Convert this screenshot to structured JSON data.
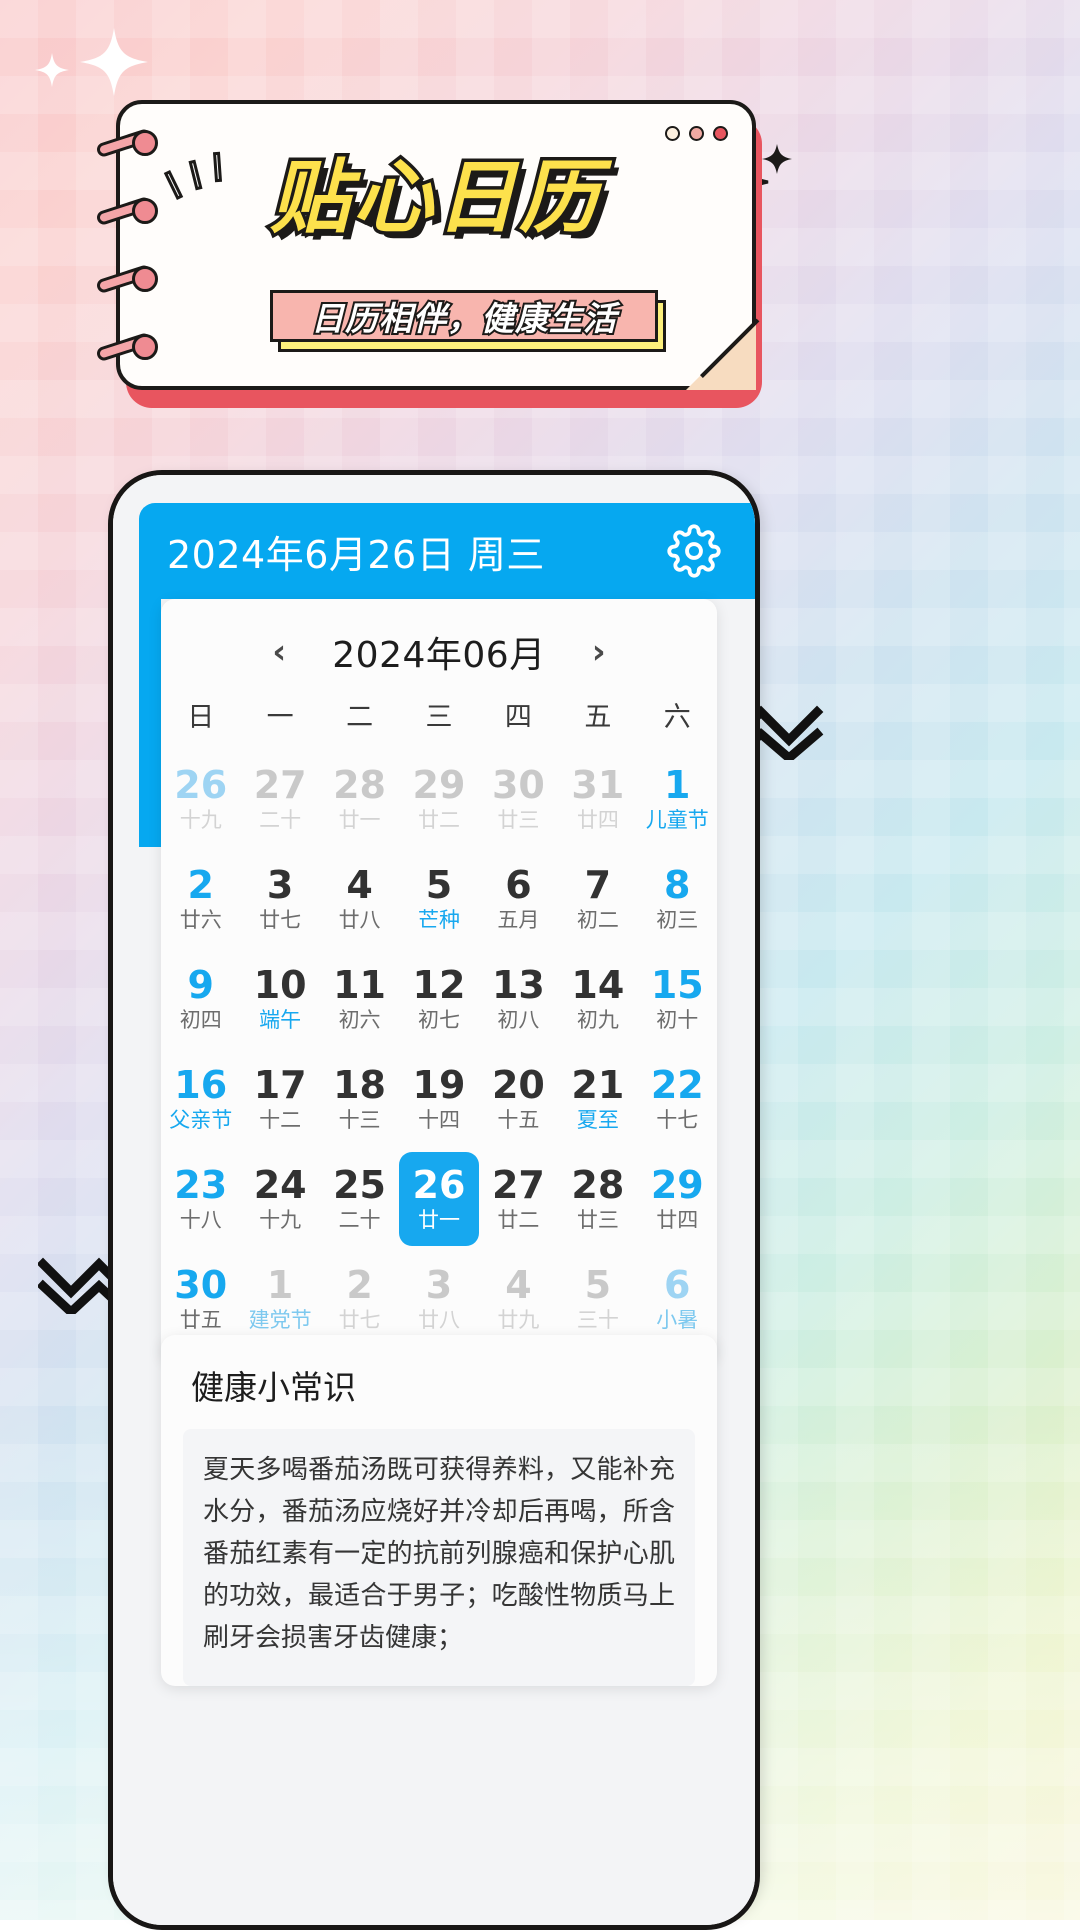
{
  "banner": {
    "title": "贴心日历",
    "subtitle": "日历相伴，健康生活",
    "dots": [
      "window-dot-1",
      "window-dot-2",
      "window-dot-3"
    ]
  },
  "app": {
    "header": {
      "date_text": "2024年6月26日 周三",
      "settings_icon": "gear-icon"
    },
    "calendar": {
      "prev_label": "‹",
      "next_label": "›",
      "title": "2024年06月",
      "weekdays": [
        "日",
        "一",
        "二",
        "三",
        "四",
        "五",
        "六"
      ],
      "weeks": [
        [
          {
            "num": "26",
            "lunar": "十九",
            "state": "out",
            "weekend": true,
            "festival": false
          },
          {
            "num": "27",
            "lunar": "二十",
            "state": "out",
            "weekend": false,
            "festival": false
          },
          {
            "num": "28",
            "lunar": "廿一",
            "state": "out",
            "weekend": false,
            "festival": false
          },
          {
            "num": "29",
            "lunar": "廿二",
            "state": "out",
            "weekend": false,
            "festival": false
          },
          {
            "num": "30",
            "lunar": "廿三",
            "state": "out",
            "weekend": false,
            "festival": false
          },
          {
            "num": "31",
            "lunar": "廿四",
            "state": "out",
            "weekend": false,
            "festival": false
          },
          {
            "num": "1",
            "lunar": "儿童节",
            "state": "cur",
            "weekend": true,
            "festival": true
          }
        ],
        [
          {
            "num": "2",
            "lunar": "廿六",
            "state": "cur",
            "weekend": true,
            "festival": false
          },
          {
            "num": "3",
            "lunar": "廿七",
            "state": "cur",
            "weekend": false,
            "festival": false
          },
          {
            "num": "4",
            "lunar": "廿八",
            "state": "cur",
            "weekend": false,
            "festival": false
          },
          {
            "num": "5",
            "lunar": "芒种",
            "state": "cur",
            "weekend": false,
            "festival": true
          },
          {
            "num": "6",
            "lunar": "五月",
            "state": "cur",
            "weekend": false,
            "festival": false
          },
          {
            "num": "7",
            "lunar": "初二",
            "state": "cur",
            "weekend": false,
            "festival": false
          },
          {
            "num": "8",
            "lunar": "初三",
            "state": "cur",
            "weekend": true,
            "festival": false
          }
        ],
        [
          {
            "num": "9",
            "lunar": "初四",
            "state": "cur",
            "weekend": true,
            "festival": false
          },
          {
            "num": "10",
            "lunar": "端午",
            "state": "cur",
            "weekend": false,
            "festival": true
          },
          {
            "num": "11",
            "lunar": "初六",
            "state": "cur",
            "weekend": false,
            "festival": false
          },
          {
            "num": "12",
            "lunar": "初七",
            "state": "cur",
            "weekend": false,
            "festival": false
          },
          {
            "num": "13",
            "lunar": "初八",
            "state": "cur",
            "weekend": false,
            "festival": false
          },
          {
            "num": "14",
            "lunar": "初九",
            "state": "cur",
            "weekend": false,
            "festival": false
          },
          {
            "num": "15",
            "lunar": "初十",
            "state": "cur",
            "weekend": true,
            "festival": false
          }
        ],
        [
          {
            "num": "16",
            "lunar": "父亲节",
            "state": "cur",
            "weekend": true,
            "festival": true
          },
          {
            "num": "17",
            "lunar": "十二",
            "state": "cur",
            "weekend": false,
            "festival": false
          },
          {
            "num": "18",
            "lunar": "十三",
            "state": "cur",
            "weekend": false,
            "festival": false
          },
          {
            "num": "19",
            "lunar": "十四",
            "state": "cur",
            "weekend": false,
            "festival": false
          },
          {
            "num": "20",
            "lunar": "十五",
            "state": "cur",
            "weekend": false,
            "festival": false
          },
          {
            "num": "21",
            "lunar": "夏至",
            "state": "cur",
            "weekend": false,
            "festival": true
          },
          {
            "num": "22",
            "lunar": "十七",
            "state": "cur",
            "weekend": true,
            "festival": false
          }
        ],
        [
          {
            "num": "23",
            "lunar": "十八",
            "state": "cur",
            "weekend": true,
            "festival": false
          },
          {
            "num": "24",
            "lunar": "十九",
            "state": "cur",
            "weekend": false,
            "festival": false
          },
          {
            "num": "25",
            "lunar": "二十",
            "state": "cur",
            "weekend": false,
            "festival": false
          },
          {
            "num": "26",
            "lunar": "廿一",
            "state": "cur",
            "weekend": false,
            "festival": false,
            "selected": true
          },
          {
            "num": "27",
            "lunar": "廿二",
            "state": "cur",
            "weekend": false,
            "festival": false
          },
          {
            "num": "28",
            "lunar": "廿三",
            "state": "cur",
            "weekend": false,
            "festival": false
          },
          {
            "num": "29",
            "lunar": "廿四",
            "state": "cur",
            "weekend": true,
            "festival": false
          }
        ],
        [
          {
            "num": "30",
            "lunar": "廿五",
            "state": "cur",
            "weekend": true,
            "festival": false
          },
          {
            "num": "1",
            "lunar": "建党节",
            "state": "out",
            "weekend": false,
            "festival": true
          },
          {
            "num": "2",
            "lunar": "廿七",
            "state": "out",
            "weekend": false,
            "festival": false
          },
          {
            "num": "3",
            "lunar": "廿八",
            "state": "out",
            "weekend": false,
            "festival": false
          },
          {
            "num": "4",
            "lunar": "廿九",
            "state": "out",
            "weekend": false,
            "festival": false
          },
          {
            "num": "5",
            "lunar": "三十",
            "state": "out",
            "weekend": false,
            "festival": false
          },
          {
            "num": "6",
            "lunar": "小暑",
            "state": "out",
            "weekend": true,
            "festival": true
          }
        ]
      ]
    },
    "health": {
      "title": "健康小常识",
      "body": "夏天多喝番茄汤既可获得养料，又能补充水分，番茄汤应烧好并冷却后再喝，所含番茄红素有一定的抗前列腺癌和保护心肌的功效，最适合于男子；吃酸性物质马上刷牙会损害牙齿健康；"
    }
  },
  "colors": {
    "accent_blue": "#06a8f0",
    "cell_blue": "#17a8ef",
    "banner_yellow": "#fde14c",
    "banner_pink": "#f8b5ae",
    "ink": "#1c1a18"
  }
}
